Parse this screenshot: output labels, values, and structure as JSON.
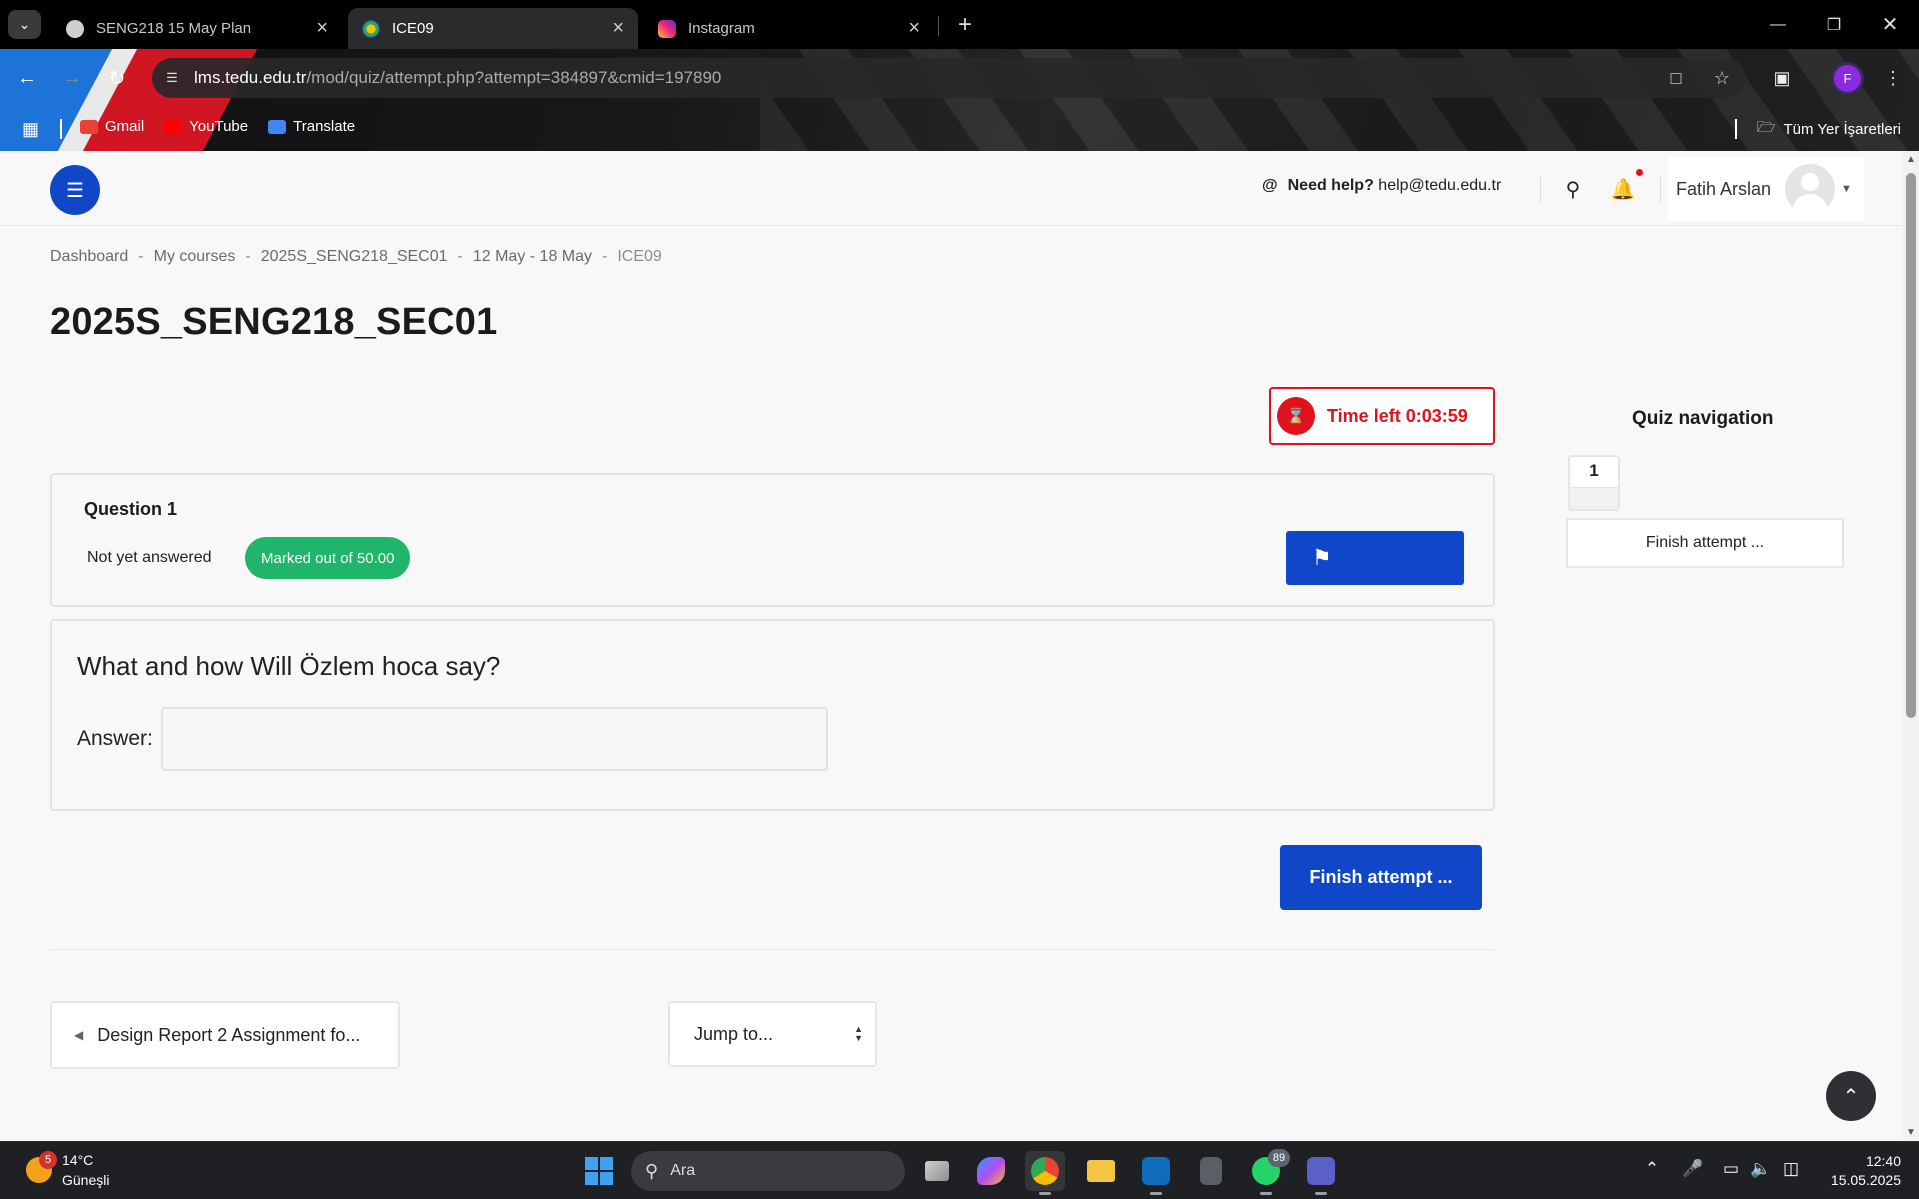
{
  "browser": {
    "tabs": [
      {
        "title": "SENG218 15 May Plan",
        "favicon": "chatgpt-icon",
        "color": "#d0d0d0",
        "active": false
      },
      {
        "title": "ICE09",
        "favicon": "tedu-logo-icon",
        "color": "#3aa84a",
        "active": true
      },
      {
        "title": "Instagram",
        "favicon": "instagram-icon",
        "color": "#e1306c",
        "active": false
      }
    ],
    "new_tab": "+",
    "url_host": "lms.tedu.edu.tr",
    "url_path": "/mod/quiz/attempt.php?attempt=384897&cmid=197890",
    "profile_initial": "F",
    "bookmarks": [
      {
        "label": "Gmail",
        "icon": "gmail-icon",
        "color": "#ea4335"
      },
      {
        "label": "YouTube",
        "icon": "youtube-icon",
        "color": "#ff0000"
      },
      {
        "label": "Translate",
        "icon": "translate-icon",
        "color": "#4285f4"
      }
    ],
    "bookmarks_right": "Tüm Yer İşaretleri"
  },
  "header": {
    "help_prefix": "Need help?",
    "help_email": "help@tedu.edu.tr",
    "user_name": "Fatih Arslan"
  },
  "breadcrumb": [
    "Dashboard",
    "My courses",
    "2025S_SENG218_SEC01",
    "12 May - 18 May",
    "ICE09"
  ],
  "breadcrumb_sep": "-",
  "page_title": "2025S_SENG218_SEC01",
  "timer": {
    "text": "Time left 0:03:59"
  },
  "question": {
    "number_label": "Question 1",
    "state": "Not yet answered",
    "marked": "Marked out of 50.00",
    "text": "What and how Will Özlem hoca say?",
    "answer_label": "Answer:",
    "answer_value": ""
  },
  "finish_button": "Finish attempt ...",
  "prev_activity": "Design Report 2 Assignment fo...",
  "jump_to": "Jump to...",
  "quiz_nav": {
    "title": "Quiz navigation",
    "question_numbers": [
      "1"
    ],
    "finish_link": "Finish attempt ..."
  },
  "colors": {
    "primary": "#0f47c8",
    "danger": "#e0131d",
    "success": "#1fb56a"
  },
  "taskbar": {
    "weather_temp": "14°C",
    "weather_desc": "Güneşli",
    "weather_badge": "5",
    "search_placeholder": "Ara",
    "whatsapp_count": "89",
    "time": "12:40",
    "date": "15.05.2025"
  }
}
